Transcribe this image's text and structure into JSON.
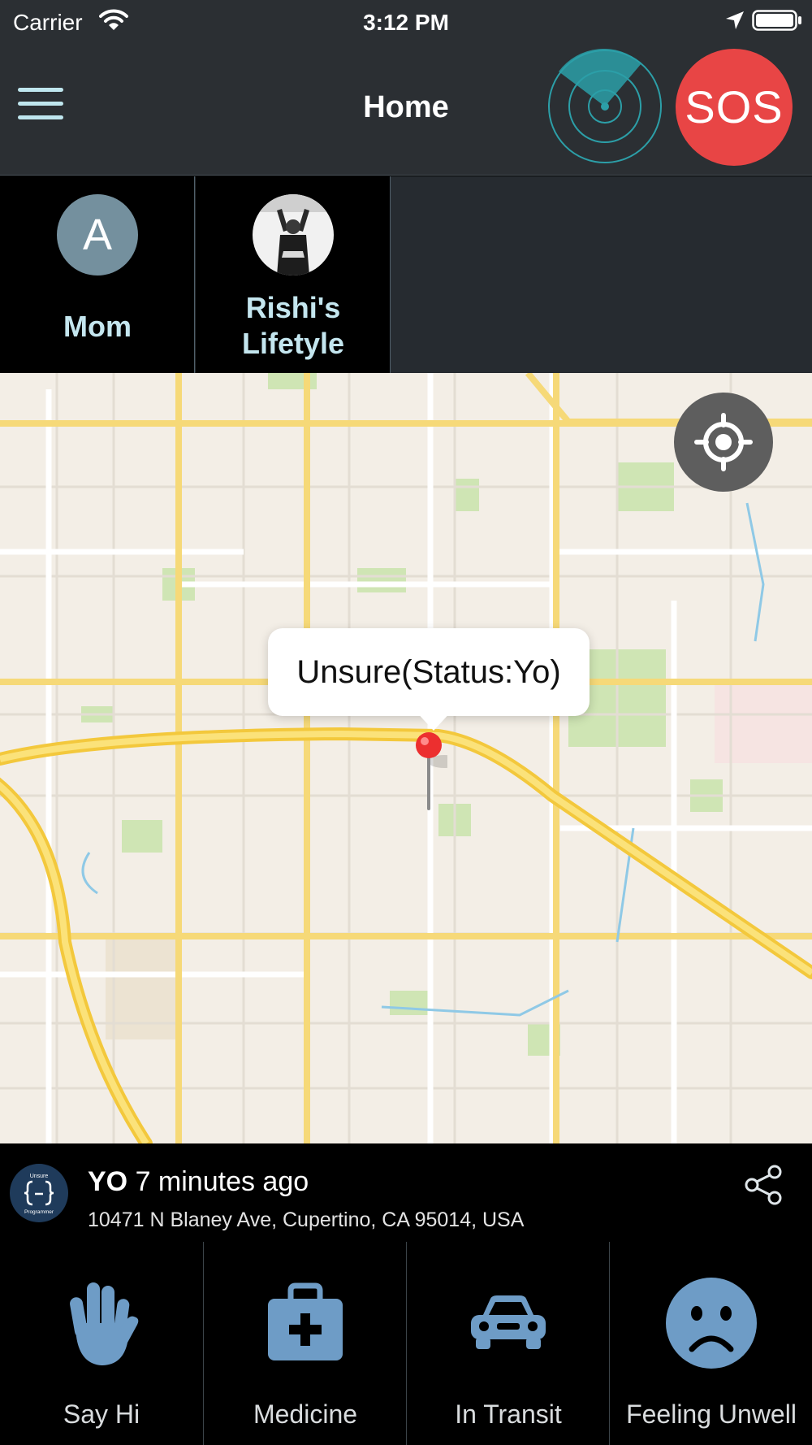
{
  "status_bar": {
    "carrier": "Carrier",
    "time": "3:12 PM"
  },
  "header": {
    "title": "Home",
    "sos_label": "SOS"
  },
  "contacts": [
    {
      "initial": "A",
      "name": "Mom"
    },
    {
      "name_line1": "Rishi's",
      "name_line2": "Lifetyle"
    }
  ],
  "map": {
    "callout": "Unsure(Status:Yo)"
  },
  "latest_status": {
    "status": "YO",
    "time_ago": "7 minutes ago",
    "address": "10471 N Blaney Ave, Cupertino, CA 95014, USA",
    "logo_text_top": "Unsure",
    "logo_text_bottom": "Programmer"
  },
  "quick_actions": [
    {
      "label": "Say Hi",
      "icon": "hand-icon"
    },
    {
      "label": "Medicine",
      "icon": "medkit-icon"
    },
    {
      "label": "In Transit",
      "icon": "car-icon"
    },
    {
      "label": "Feeling Unwell",
      "icon": "sad-face-icon"
    }
  ],
  "colors": {
    "nav_background": "#2b2f33",
    "sos": "#e84545",
    "contact_name": "#c4e6ef",
    "radar": "#2c9fa8",
    "icon_blue": "#6e9cc6"
  }
}
